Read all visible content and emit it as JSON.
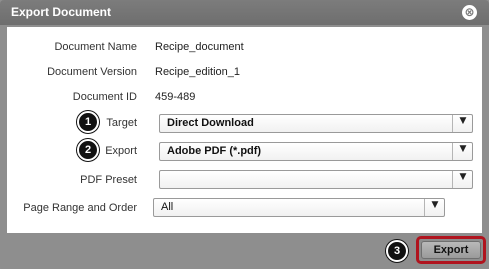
{
  "dialog": {
    "title": "Export Document",
    "close_icon_glyph": "⊗"
  },
  "info": [
    {
      "label": "Document Name",
      "value": "Recipe_document"
    },
    {
      "label": "Document Version",
      "value": "Recipe_edition_1"
    },
    {
      "label": "Document ID",
      "value": "459-489"
    }
  ],
  "fields": {
    "target": {
      "label": "Target",
      "value": "Direct Download",
      "badge": "1"
    },
    "export": {
      "label": "Export",
      "value": "Adobe PDF (*.pdf)",
      "badge": "2"
    },
    "pdf_preset": {
      "label": "PDF Preset",
      "value": ""
    },
    "page_range": {
      "label": "Page Range and Order",
      "value": "All"
    }
  },
  "footer": {
    "export_label": "Export",
    "badge": "3"
  },
  "icons": {
    "dropdown_arrow": "▼",
    "accent_highlight": "#b0141e"
  }
}
